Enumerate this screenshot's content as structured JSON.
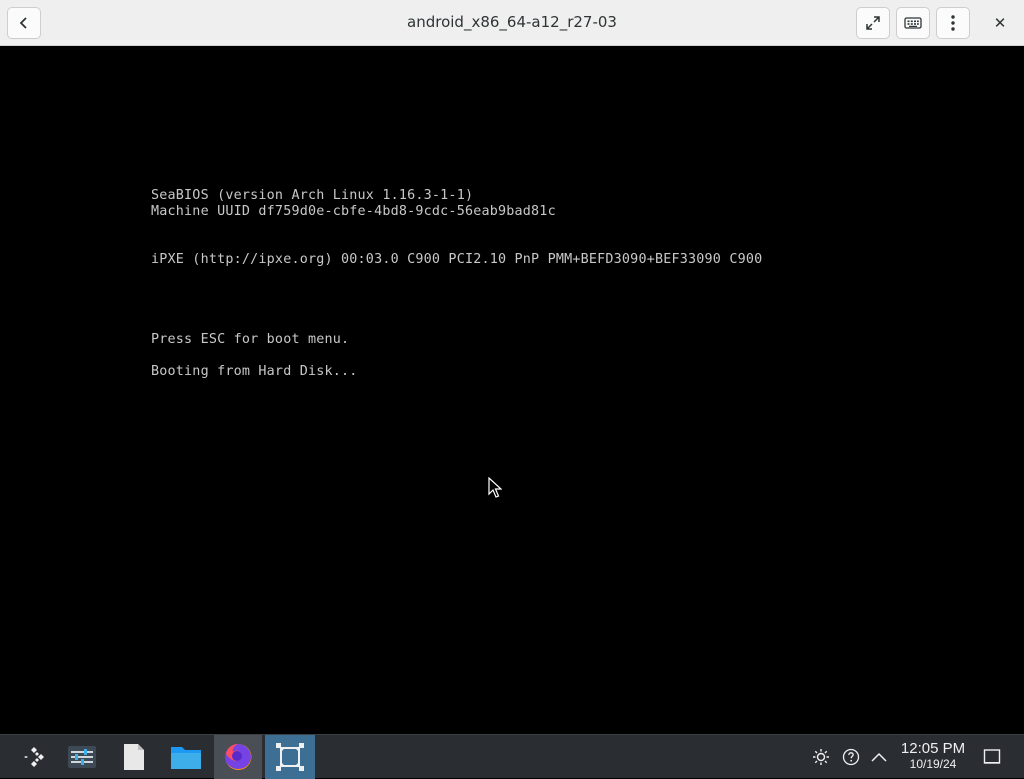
{
  "window": {
    "title": "android_x86_64-a12_r27-03",
    "back_icon": "chevron-left-icon",
    "fullscreen_icon": "expand-arrows-icon",
    "keyboard_icon": "keyboard-icon",
    "menu_icon": "vertical-dots-icon",
    "close_icon": "close-icon",
    "close_label": "✕"
  },
  "console": {
    "lines": [
      "SeaBIOS (version Arch Linux 1.16.3-1-1)",
      "Machine UUID df759d0e-cbfe-4bd8-9cdc-56eab9bad81c",
      "iPXE (http://ipxe.org) 00:03.0 C900 PCI2.10 PnP PMM+BEFD3090+BEF33090 C900",
      "Press ESC for boot menu.",
      "Booting from Hard Disk..."
    ]
  },
  "taskbar": {
    "launchers": [
      {
        "name": "application-launcher-icon"
      },
      {
        "name": "system-settings-icon"
      },
      {
        "name": "text-document-icon"
      },
      {
        "name": "folder-icon"
      },
      {
        "name": "firefox-icon"
      },
      {
        "name": "virtual-machine-icon"
      }
    ],
    "tray": {
      "brightness_icon": "brightness-icon",
      "help_icon": "help-icon",
      "expand_icon": "chevron-up-icon",
      "show_desktop_icon": "show-desktop-icon"
    },
    "clock": {
      "time": "12:05 PM",
      "date": "10/19/24"
    }
  },
  "colors": {
    "titlebar_bg": "#f0efef",
    "console_text": "#c8c8c8",
    "taskbar_bg": "#2a2e32",
    "active_task": "#3d6e93"
  }
}
